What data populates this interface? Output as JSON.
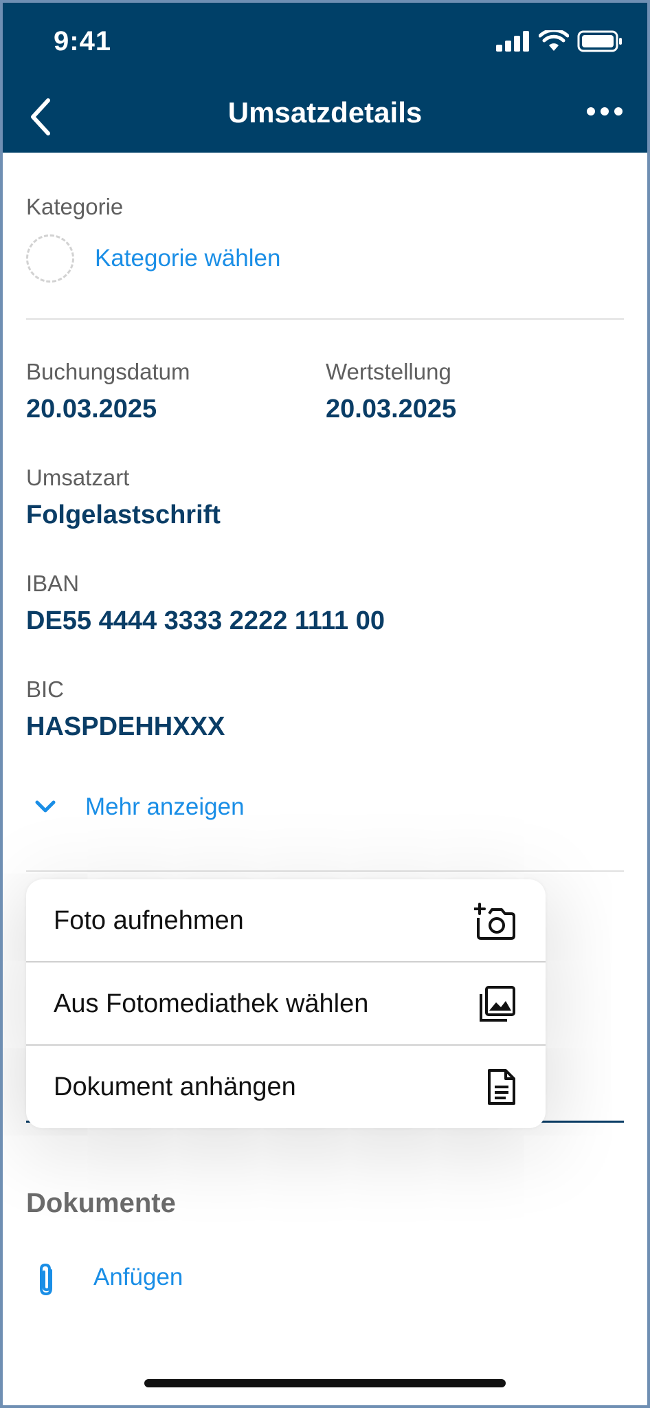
{
  "status_bar": {
    "time": "9:41"
  },
  "header": {
    "title": "Umsatzdetails"
  },
  "category": {
    "label": "Kategorie",
    "link": "Kategorie wählen"
  },
  "details": {
    "booking_date_label": "Buchungsdatum",
    "booking_date": "20.03.2025",
    "value_date_label": "Wertstellung",
    "value_date": "20.03.2025",
    "type_label": "Umsatzart",
    "type": "Folgelastschrift",
    "iban_label": "IBAN",
    "iban": "DE55 4444 3333 2222 1111 00",
    "bic_label": "BIC",
    "bic": "HASPDEHHXXX"
  },
  "more": {
    "label": "Mehr anzeigen"
  },
  "menu": {
    "items": [
      {
        "label": "Foto aufnehmen",
        "icon": "camera-add-icon"
      },
      {
        "label": "Aus Fotomediathek wählen",
        "icon": "photo-library-icon"
      },
      {
        "label": "Dokument anhängen",
        "icon": "document-icon"
      }
    ]
  },
  "documents": {
    "title": "Dokumente",
    "attach_label": "Anfügen"
  },
  "colors": {
    "header_bg": "#004068",
    "link": "#1a8ee6",
    "value": "#0a3d66"
  }
}
